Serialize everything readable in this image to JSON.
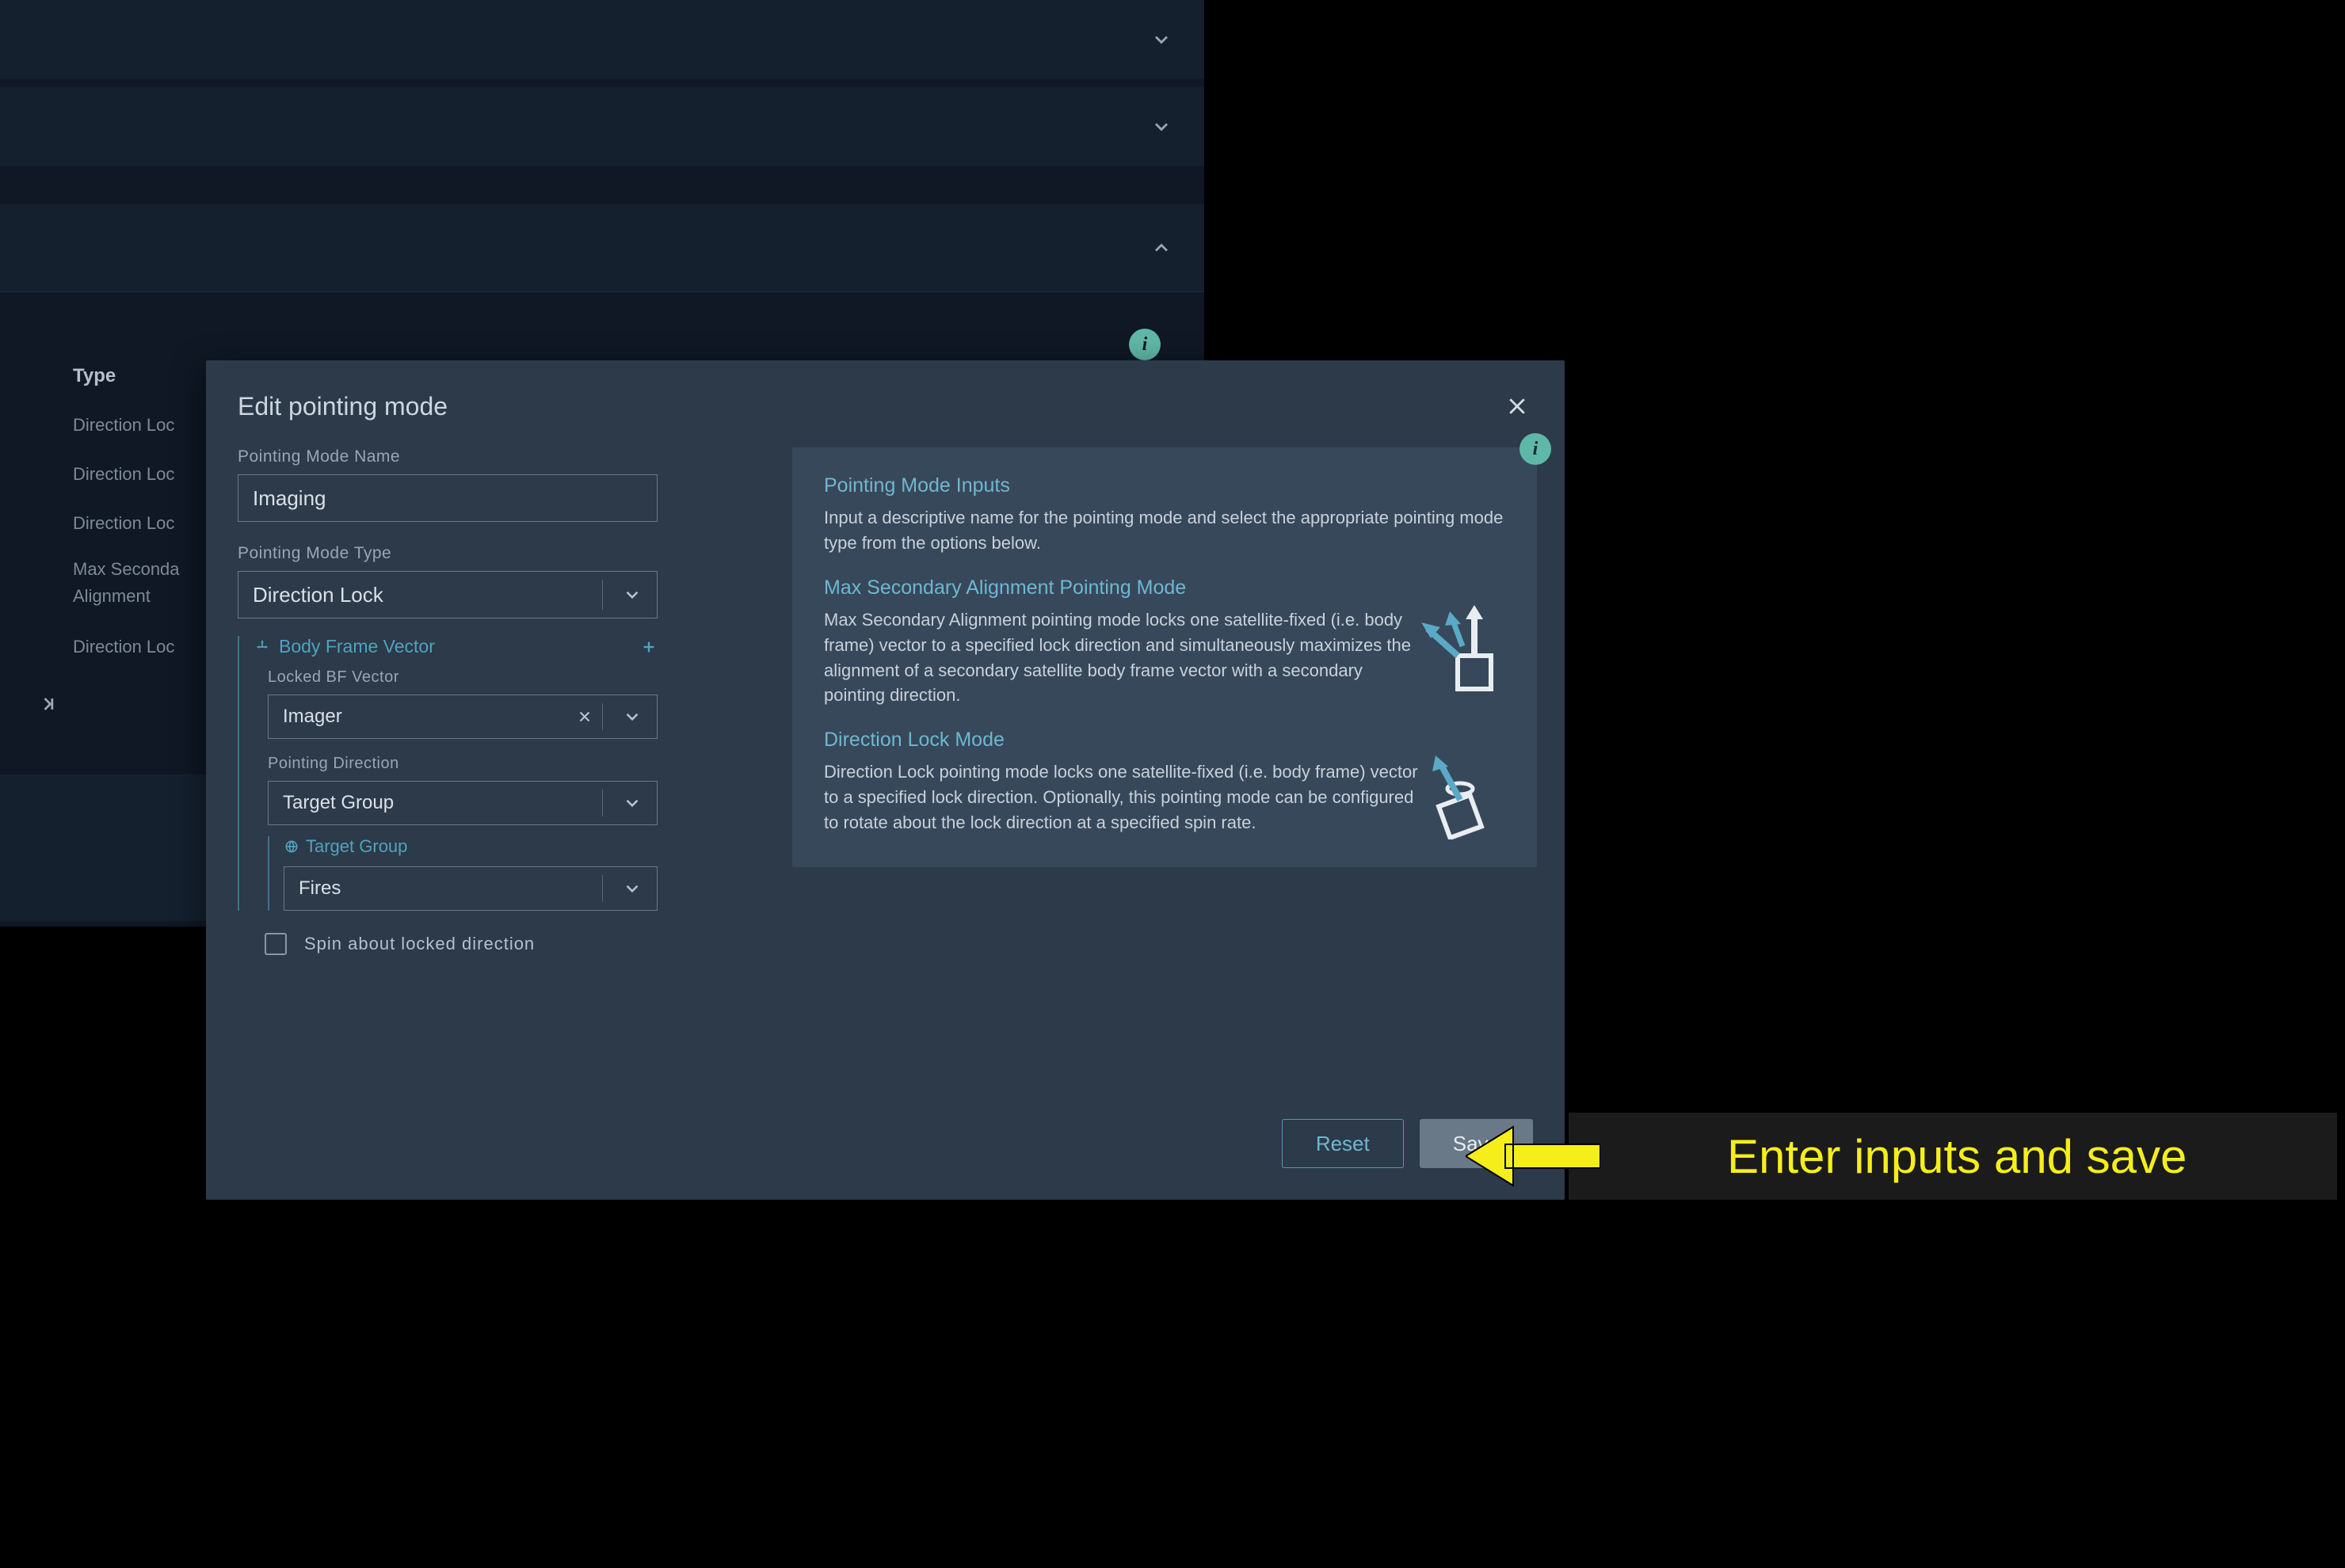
{
  "background": {
    "type_header": "Type",
    "list": [
      "Direction Loc",
      "Direction Loc",
      "Direction Loc",
      "Max Seconda",
      "Alignment",
      "Direction Loc"
    ]
  },
  "modal": {
    "title": "Edit pointing mode",
    "form": {
      "name_label": "Pointing Mode Name",
      "name_value": "Imaging",
      "type_label": "Pointing Mode Type",
      "type_value": "Direction Lock",
      "body_frame_header": "Body Frame Vector",
      "locked_bf_label": "Locked BF Vector",
      "locked_bf_value": "Imager",
      "pointing_dir_label": "Pointing Direction",
      "pointing_dir_value": "Target Group",
      "target_group_header": "Target Group",
      "target_group_value": "Fires",
      "spin_label": "Spin about locked direction"
    },
    "info": {
      "h1": "Pointing Mode Inputs",
      "p1": "Input a descriptive name for the pointing mode and select the appropriate pointing mode type from the options below.",
      "h2": "Max Secondary Alignment Pointing Mode",
      "p2": "Max Secondary Alignment pointing mode locks one satellite-fixed (i.e. body frame) vector to a specified lock direction and simultaneously maximizes the alignment of a secondary satellite body frame vector with a secondary pointing direction.",
      "h3": "Direction Lock Mode",
      "p3": "Direction Lock pointing mode locks one satellite-fixed (i.e. body frame) vector to a specified lock direction. Optionally, this pointing mode can be configured to rotate about the lock direction at a specified spin rate."
    },
    "buttons": {
      "reset": "Reset",
      "save": "Save"
    }
  },
  "callout": {
    "text": "Enter inputs and save"
  }
}
